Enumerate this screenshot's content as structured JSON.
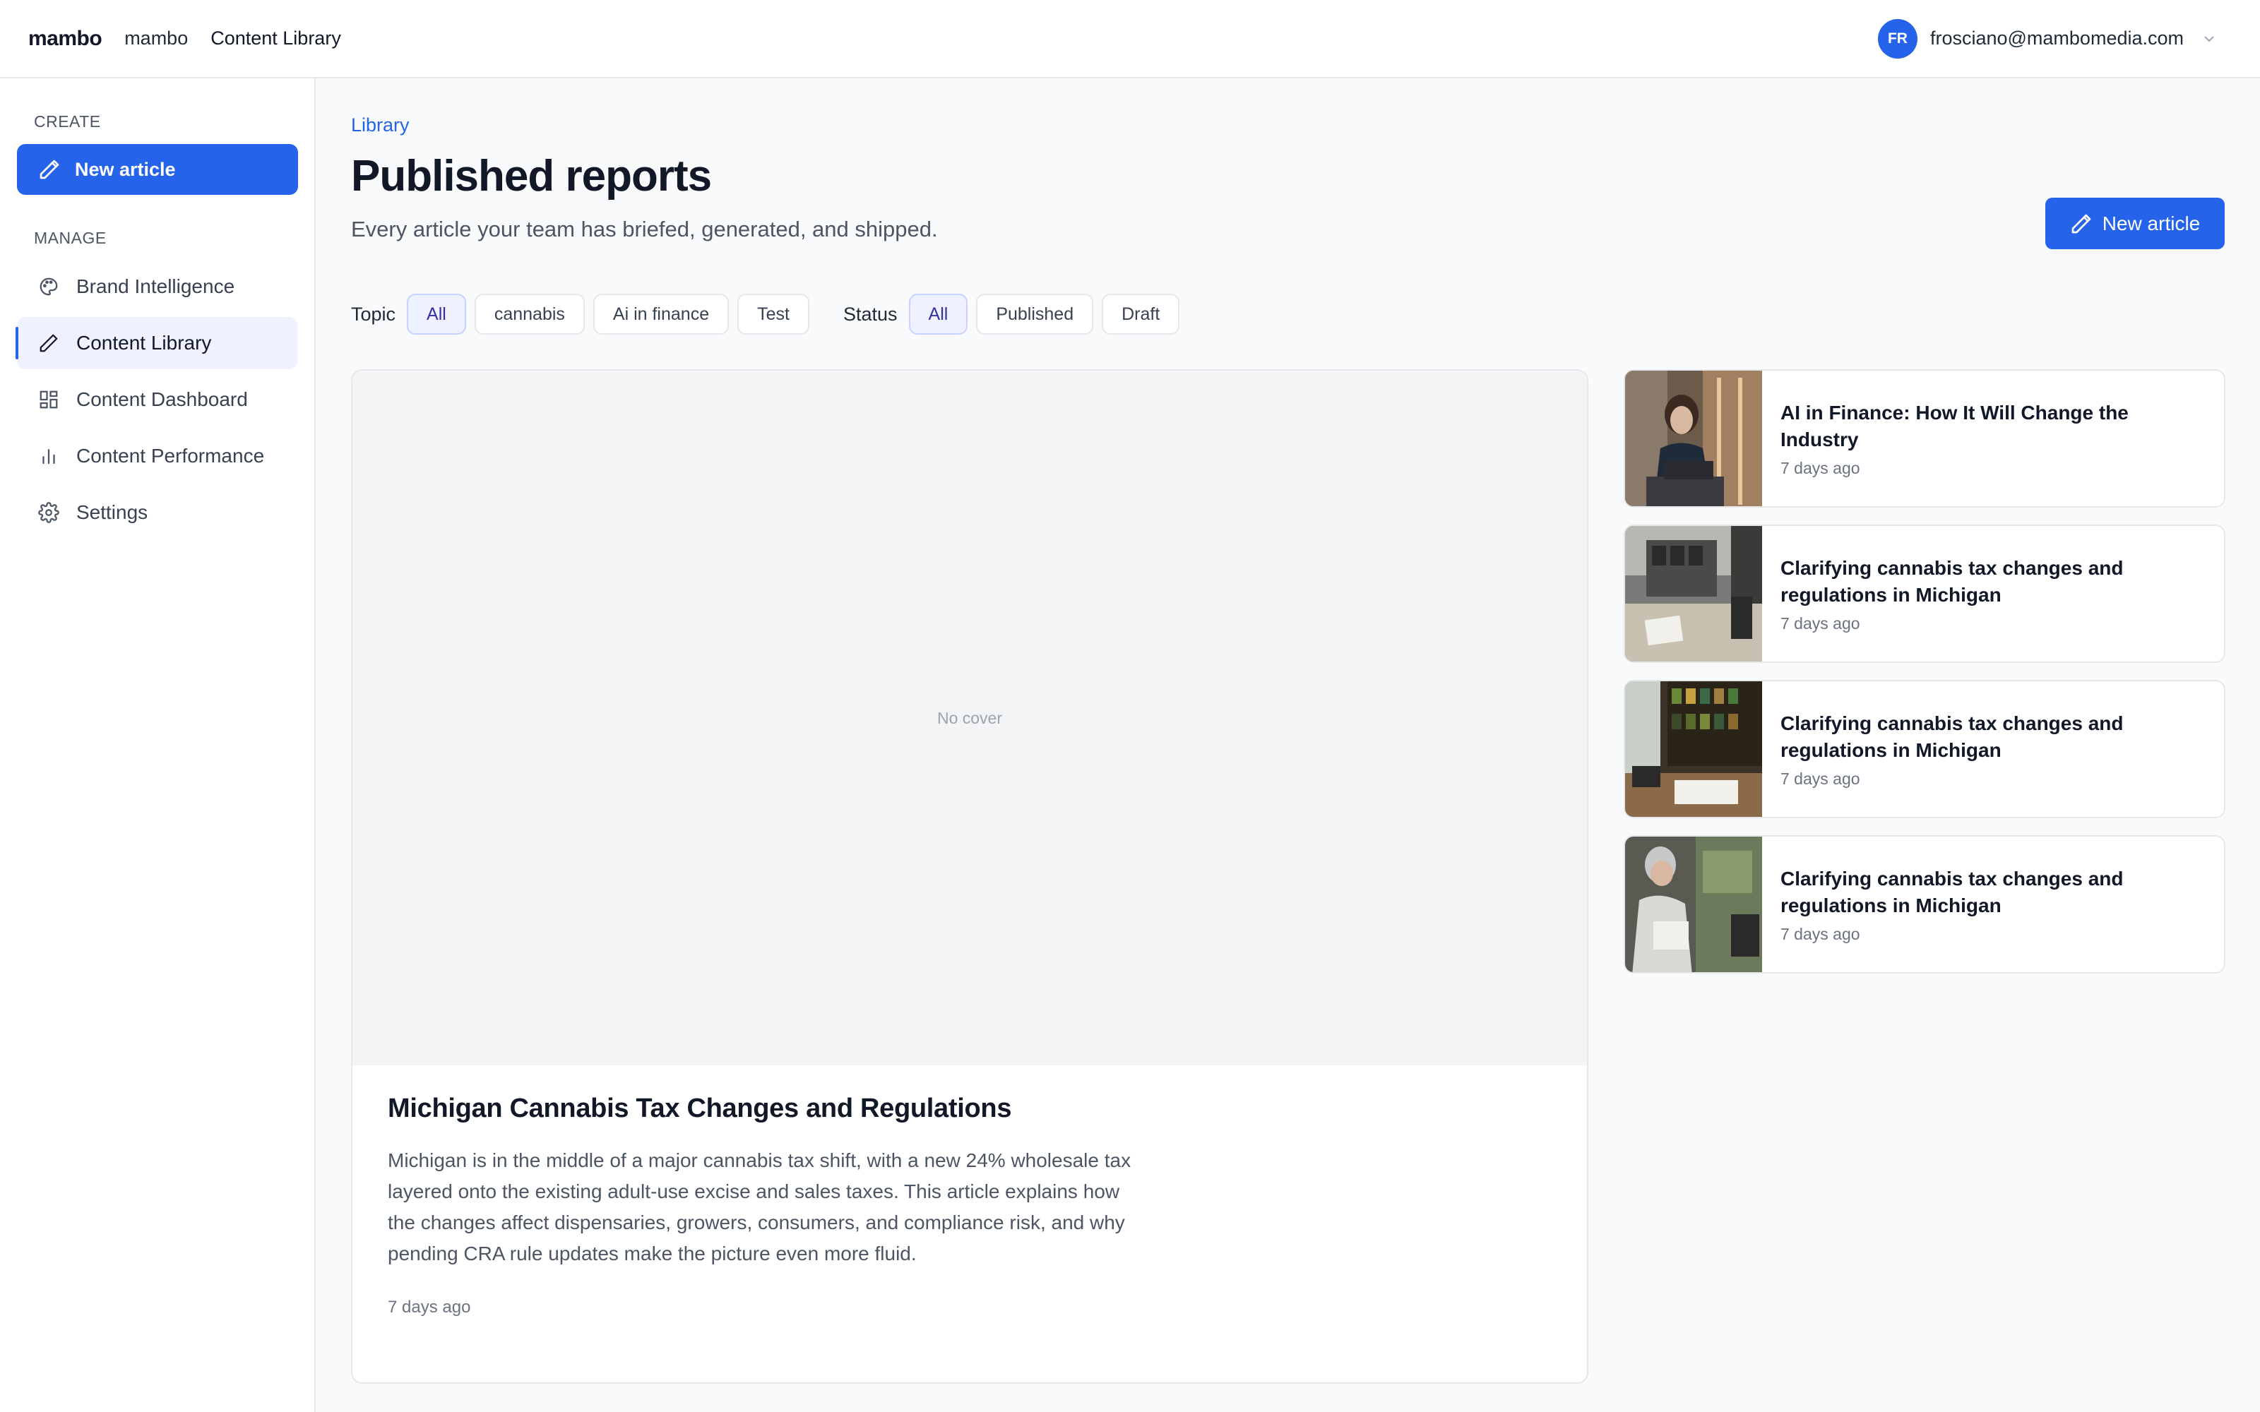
{
  "topbar": {
    "brand": "mambo",
    "crumb_workspace": "mambo",
    "crumb_page": "Content Library",
    "user_initials": "FR",
    "user_email": "frosciano@mambomedia.com"
  },
  "sidebar": {
    "create_label": "CREATE",
    "new_article_label": "New article",
    "manage_label": "MANAGE",
    "items": [
      {
        "label": "Brand Intelligence",
        "icon": "palette-icon"
      },
      {
        "label": "Content Library",
        "icon": "pencil-icon",
        "active": true
      },
      {
        "label": "Content Dashboard",
        "icon": "dashboard-grid-icon"
      },
      {
        "label": "Content Performance",
        "icon": "bar-chart-icon"
      },
      {
        "label": "Settings",
        "icon": "gear-icon"
      }
    ]
  },
  "main": {
    "breadcrumb": "Library",
    "title": "Published reports",
    "subtitle": "Every article your team has briefed, generated, and shipped.",
    "new_article_label": "New article",
    "filters": {
      "topic_label": "Topic",
      "topics": [
        "All",
        "cannabis",
        "Ai in finance",
        "Test"
      ],
      "topic_selected": "All",
      "status_label": "Status",
      "statuses": [
        "All",
        "Published",
        "Draft"
      ],
      "status_selected": "All"
    },
    "featured": {
      "cover_placeholder": "No cover",
      "title": "Michigan Cannabis Tax Changes and Regulations",
      "excerpt": "Michigan is in the middle of a major cannabis tax shift, with a new 24% wholesale tax layered onto the existing adult-use excise and sales taxes. This article explains how the changes affect dispensaries, growers, consumers, and compliance risk, and why pending CRA rule updates make the picture even more fluid.",
      "time": "7 days ago"
    },
    "side_articles": [
      {
        "title": "AI in Finance: How It Will Change the Industry",
        "time": "7 days ago"
      },
      {
        "title": "Clarifying cannabis tax changes and regulations in Michigan",
        "time": "7 days ago"
      },
      {
        "title": "Clarifying cannabis tax changes and regulations in Michigan",
        "time": "7 days ago"
      },
      {
        "title": "Clarifying cannabis tax changes and regulations in Michigan",
        "time": "7 days ago"
      }
    ]
  },
  "colors": {
    "accent": "#2563eb",
    "active_bg": "#eef2ff",
    "active_text": "#3730a3"
  }
}
